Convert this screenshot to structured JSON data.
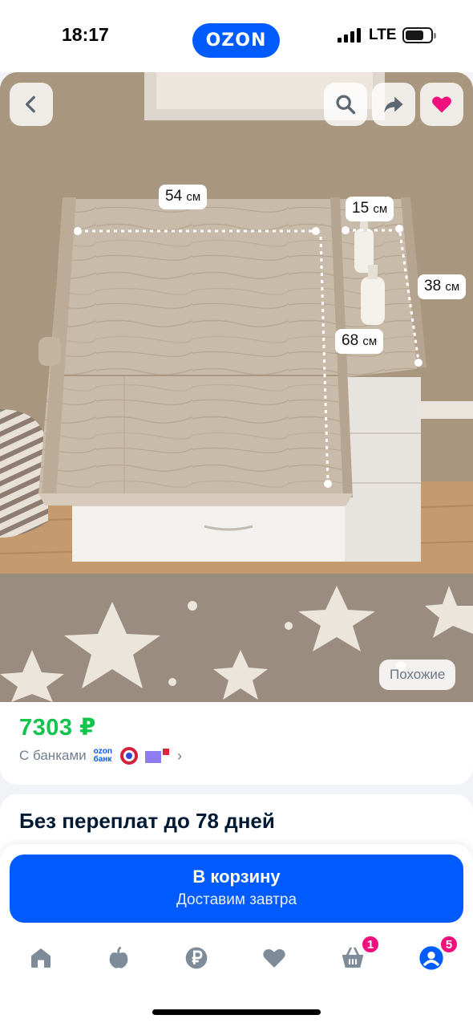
{
  "status_bar": {
    "time": "18:17",
    "network": "LTE"
  },
  "brand": {
    "logo_text": "OZON",
    "accent_color": "#005bff"
  },
  "image_toolbar": {
    "back_icon": "chevron-left-icon",
    "search_icon": "search-icon",
    "share_icon": "share-arrow-icon",
    "favorite_icon": "heart-icon",
    "favorite_color": "#f1117e"
  },
  "dimensions": {
    "width_main": "54",
    "width_shelf": "15",
    "depth_shelf": "38",
    "depth_main": "68",
    "unit": "см"
  },
  "similar_label": "Похожие",
  "price": {
    "value": "7303 ₽",
    "color": "#10c44c",
    "banks_label": "С банками",
    "ozon_bank_line1": "ozon",
    "ozon_bank_line2": "банк"
  },
  "installment": {
    "title": "Без переплат до 78 дней"
  },
  "cart_button": {
    "title": "В корзину",
    "subtitle": "Доставим завтра"
  },
  "tabs": [
    {
      "name": "home",
      "icon": "home-icon",
      "badge": ""
    },
    {
      "name": "fresh",
      "icon": "apple-icon",
      "badge": ""
    },
    {
      "name": "finance",
      "icon": "ruble-icon",
      "badge": ""
    },
    {
      "name": "favorites",
      "icon": "heart-icon",
      "badge": ""
    },
    {
      "name": "cart",
      "icon": "basket-icon",
      "badge": "1"
    },
    {
      "name": "profile",
      "icon": "profile-icon",
      "badge": "5"
    }
  ]
}
